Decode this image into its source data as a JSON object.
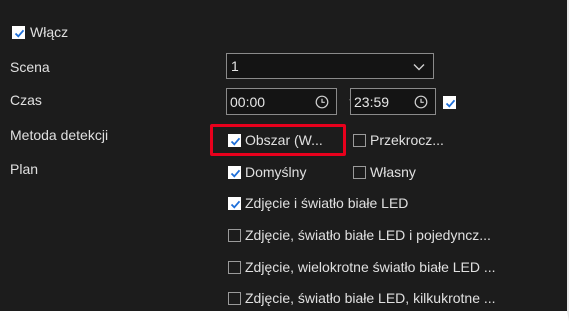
{
  "enable": {
    "label": "Włącz",
    "checked": true
  },
  "scene": {
    "label": "Scena",
    "value": "1"
  },
  "time": {
    "label": "Czas",
    "start": "00:00",
    "separator": "~",
    "end": "23:59",
    "checked": true
  },
  "detection": {
    "label": "Metoda detekcji",
    "area": {
      "label": "Obszar (W...",
      "checked": true
    },
    "cross": {
      "label": "Przekrocz...",
      "checked": false
    }
  },
  "plan": {
    "label": "Plan",
    "default": {
      "label": "Domyślny",
      "checked": true
    },
    "custom": {
      "label": "Własny",
      "checked": false
    }
  },
  "actions": [
    {
      "label": "Zdjęcie i światło białe LED",
      "checked": true
    },
    {
      "label": "Zdjęcie, światło białe LED i pojedyncz...",
      "checked": false
    },
    {
      "label": "Zdjęcie, wielokrotne światło białe LED ...",
      "checked": false
    },
    {
      "label": "Zdjęcie, światło białe LED, kilkukrotne ...",
      "checked": false
    }
  ],
  "colors": {
    "highlight": "#e8001c",
    "background": "#1c1c1c",
    "check": "#1e6fd9"
  }
}
